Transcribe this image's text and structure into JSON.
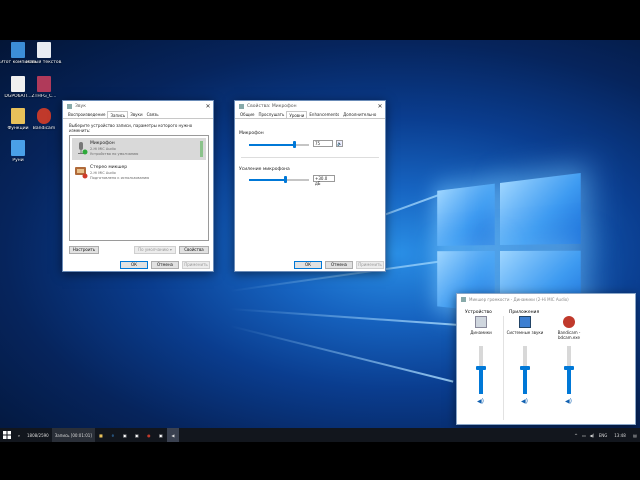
{
  "desktop": {
    "icons": [
      {
        "label": "Этот компьютер",
        "icon": "computer-icon",
        "color": "#3c8ed8"
      },
      {
        "label": "Новый текстов...",
        "icon": "text-file-icon",
        "color": "#e8ecf2"
      },
      {
        "label": "DGPO6ATI...",
        "icon": "document-icon",
        "color": "#f0f0f0"
      },
      {
        "label": "ZTHFG_C...",
        "icon": "archive-icon",
        "color": "#b03a5a"
      },
      {
        "label": "Функции",
        "icon": "folder-icon",
        "color": "#e8c15a"
      },
      {
        "label": "Bandicam",
        "icon": "bandicam-icon",
        "color": "#c0392b"
      },
      {
        "label": "Руни",
        "icon": "app-icon",
        "color": "#4aa0e8"
      }
    ]
  },
  "sound_dialog": {
    "title": "Звук",
    "tabs": [
      "Воспроизведение",
      "Запись",
      "Звуки",
      "Связь"
    ],
    "active_tab": "Запись",
    "instruction": "Выберите устройство записи, параметры которого нужно изменить:",
    "devices": [
      {
        "name": "Микрофон",
        "line2": "2-Hi MIC Audio",
        "line3": "Устройство по умолчанию",
        "icon": "microphone-icon",
        "selected": true
      },
      {
        "name": "Стерео микшер",
        "line2": "2-Hi MIC Audio",
        "line3": "Подготовлено к использованию",
        "icon": "stereo-mixer-icon",
        "selected": false
      }
    ],
    "configure_label": "Настроить",
    "default_label": "По умолчанию",
    "properties_label": "Свойства",
    "ok_label": "ОК",
    "cancel_label": "Отмена",
    "apply_label": "Применить"
  },
  "mic_props": {
    "title": "Свойства: Микрофон",
    "tabs": [
      "Общие",
      "Прослушать",
      "Уровни",
      "Enhancements",
      "Дополнительно"
    ],
    "active_tab": "Уровни",
    "mic_label": "Микрофон",
    "mic_value": "75",
    "mic_level": 0.75,
    "boost_label": "Усиление микрофона",
    "boost_value": "+30.0 дБ",
    "boost_level": 0.6,
    "ok_label": "ОК",
    "cancel_label": "Отмена",
    "apply_label": "Применить"
  },
  "mixer": {
    "title": "Микшер громкости - Динамики (2-Hi MIC Audio)",
    "device_header": "Устройство",
    "apps_header": "Приложения",
    "channels": [
      {
        "label": "Динамики",
        "icon": "speaker-device-icon",
        "level": 0.55
      },
      {
        "label": "Системные звуки",
        "icon": "system-sounds-icon",
        "level": 0.55
      },
      {
        "label": "Bandicam - bdcam.exe",
        "icon": "bandicam-icon",
        "level": 0.55
      }
    ]
  },
  "taskbar": {
    "search_text": "",
    "small_text": "1808/2590",
    "rec_text": "Запись [00:01:01]",
    "lang": "ENG",
    "time": "13:48"
  }
}
